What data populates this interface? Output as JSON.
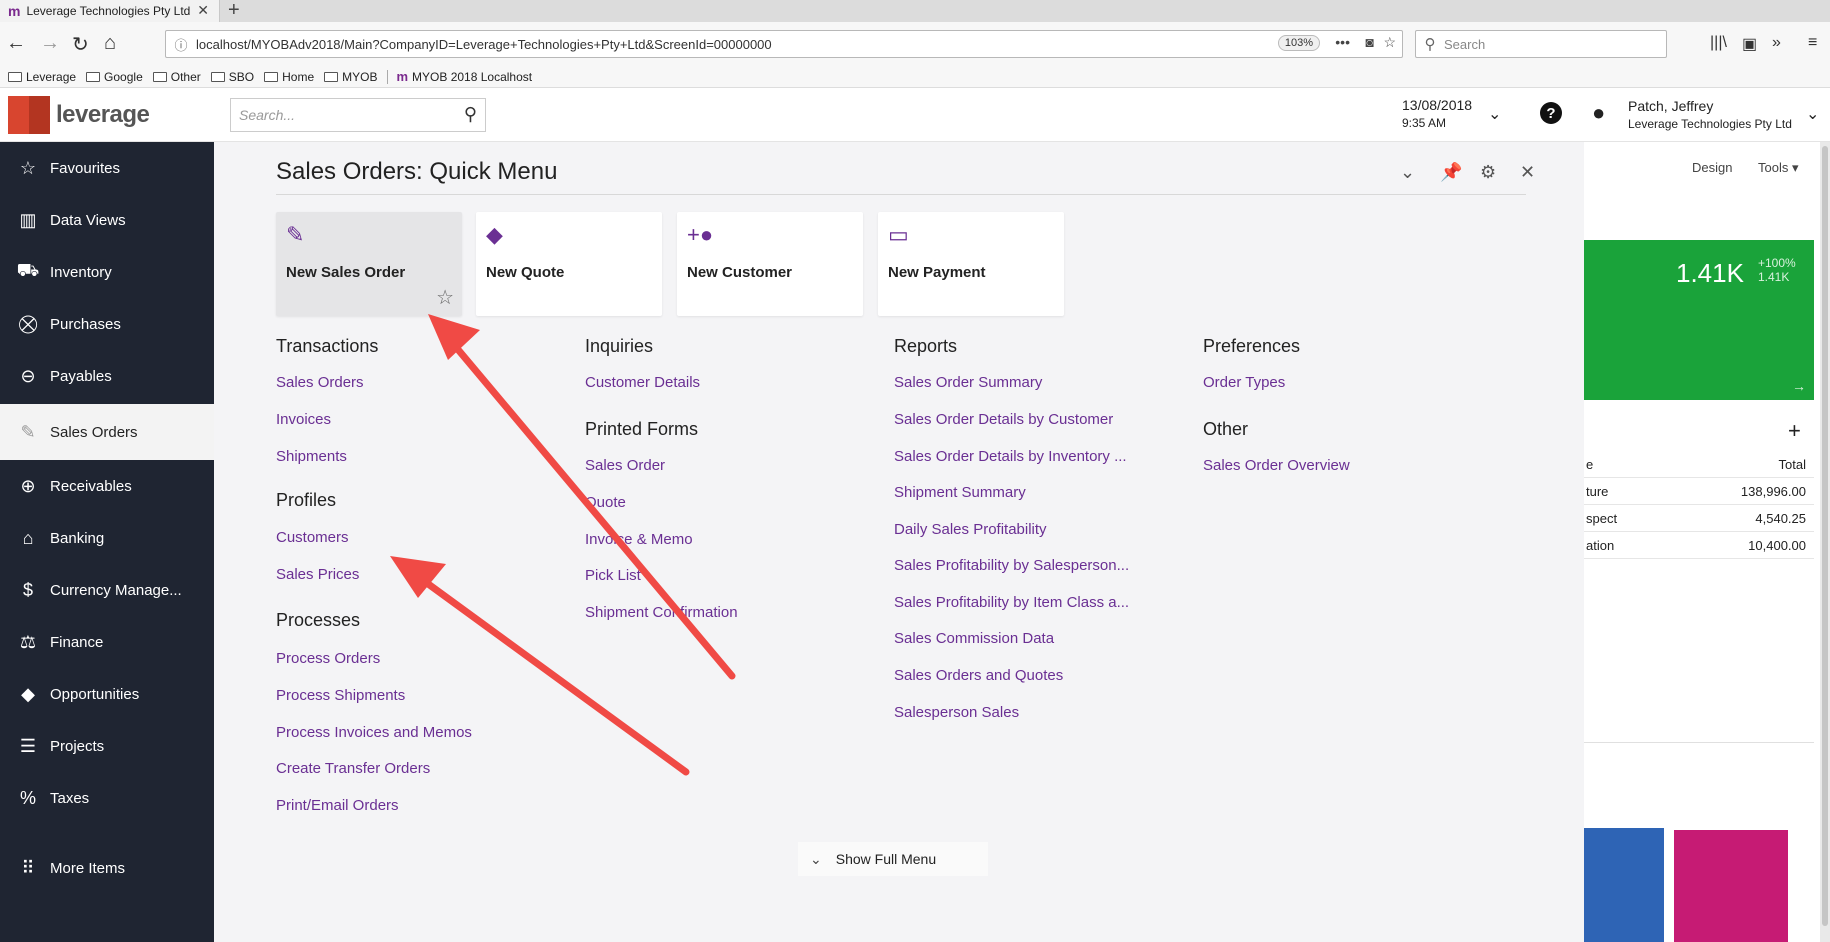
{
  "browser": {
    "tab_title": "Leverage Technologies Pty Ltd",
    "url": "localhost/MYOBAdv2018/Main?CompanyID=Leverage+Technologies+Pty+Ltd&ScreenId=00000000",
    "zoom": "103%",
    "search_placeholder": "Search",
    "bookmarks": [
      "Leverage",
      "Google",
      "Other",
      "SBO",
      "Home",
      "MYOB",
      "MYOB 2018 Localhost"
    ]
  },
  "header": {
    "logo_text": "leverage",
    "search_placeholder": "Search...",
    "date": "13/08/2018",
    "time": "9:35 AM",
    "user_name": "Patch, Jeffrey",
    "company": "Leverage Technologies Pty Ltd"
  },
  "sidebar": {
    "items": [
      {
        "label": "Favourites",
        "icon": "star-icon"
      },
      {
        "label": "Data Views",
        "icon": "chart-icon"
      },
      {
        "label": "Inventory",
        "icon": "truck-icon"
      },
      {
        "label": "Purchases",
        "icon": "cart-icon"
      },
      {
        "label": "Payables",
        "icon": "minus-circle-icon"
      },
      {
        "label": "Sales Orders",
        "icon": "edit-icon"
      },
      {
        "label": "Receivables",
        "icon": "plus-circle-icon"
      },
      {
        "label": "Banking",
        "icon": "bank-icon"
      },
      {
        "label": "Currency Manage...",
        "icon": "dollar-icon"
      },
      {
        "label": "Finance",
        "icon": "scales-icon"
      },
      {
        "label": "Opportunities",
        "icon": "tag-icon"
      },
      {
        "label": "Projects",
        "icon": "projects-icon"
      },
      {
        "label": "Taxes",
        "icon": "percent-icon"
      },
      {
        "label": "More Items",
        "icon": "grid-icon"
      }
    ]
  },
  "quick_menu": {
    "title": "Sales Orders: Quick Menu",
    "tiles": [
      {
        "label": "New Sales Order",
        "icon": "edit-icon"
      },
      {
        "label": "New Quote",
        "icon": "tag-icon"
      },
      {
        "label": "New Customer",
        "icon": "add-person-icon"
      },
      {
        "label": "New Payment",
        "icon": "card-icon"
      }
    ],
    "transactions": {
      "heading": "Transactions",
      "links": [
        "Sales Orders",
        "Invoices",
        "Shipments"
      ]
    },
    "profiles": {
      "heading": "Profiles",
      "links": [
        "Customers",
        "Sales Prices"
      ]
    },
    "processes": {
      "heading": "Processes",
      "links": [
        "Process Orders",
        "Process Shipments",
        "Process Invoices and Memos",
        "Create Transfer Orders",
        "Print/Email Orders"
      ]
    },
    "inquiries": {
      "heading": "Inquiries",
      "links": [
        "Customer Details"
      ]
    },
    "printed_forms": {
      "heading": "Printed Forms",
      "links": [
        "Sales Order",
        "Quote",
        "Invoice & Memo",
        "Pick List",
        "Shipment Confirmation"
      ]
    },
    "reports": {
      "heading": "Reports",
      "links": [
        "Sales Order Summary",
        "Sales Order Details by Customer",
        "Sales Order Details by Inventory ...",
        "Shipment Summary",
        "Daily Sales Profitability",
        "Sales Profitability by Salesperson...",
        "Sales Profitability by Item Class a...",
        "Sales Commission Data",
        "Sales Orders and Quotes",
        "Salesperson Sales"
      ]
    },
    "preferences": {
      "heading": "Preferences",
      "links": [
        "Order Types"
      ]
    },
    "other": {
      "heading": "Other",
      "links": [
        "Sales Order Overview"
      ]
    },
    "show_full_menu": "Show Full Menu"
  },
  "dashboard": {
    "design_label": "Design",
    "tools_label": "Tools",
    "kpi_value": "1.41K",
    "kpi_change": "+100%",
    "kpi_prev": "1.41K",
    "col_left": "e",
    "col_total": "Total",
    "rows": [
      {
        "name": "ture",
        "total": "138,996.00"
      },
      {
        "name": "spect",
        "total": "4,540.25"
      },
      {
        "name": "ation",
        "total": "10,400.00"
      }
    ],
    "kpi_color": "#1aa33a",
    "bar_colors": [
      "#2e64b5",
      "#c61b74"
    ]
  },
  "annotations": {
    "arrow_color": "#f04a45"
  }
}
